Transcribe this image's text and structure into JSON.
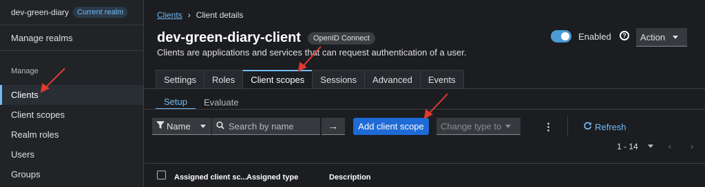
{
  "sidebar": {
    "realm_name": "dev-green-diary",
    "realm_badge": "Current realm",
    "manage_realms": "Manage realms",
    "section_label": "Manage",
    "items": [
      {
        "label": "Clients"
      },
      {
        "label": "Client scopes"
      },
      {
        "label": "Realm roles"
      },
      {
        "label": "Users"
      },
      {
        "label": "Groups"
      }
    ]
  },
  "breadcrumb": {
    "parent": "Clients",
    "current": "Client details"
  },
  "header": {
    "title": "dev-green-diary-client",
    "protocol_badge": "OpenID Connect",
    "subtitle": "Clients are applications and services that can request authentication of a user.",
    "enabled_label": "Enabled",
    "enabled": true,
    "action_label": "Action"
  },
  "tabs": [
    {
      "label": "Settings"
    },
    {
      "label": "Roles"
    },
    {
      "label": "Client scopes"
    },
    {
      "label": "Sessions"
    },
    {
      "label": "Advanced"
    },
    {
      "label": "Events"
    }
  ],
  "subtabs": [
    {
      "label": "Setup"
    },
    {
      "label": "Evaluate"
    }
  ],
  "toolbar": {
    "filter_label": "Name",
    "search_placeholder": "Search by name",
    "add_label": "Add client scope",
    "change_type_label": "Change type to",
    "refresh_label": "Refresh"
  },
  "pagination": {
    "range": "1 - 14"
  },
  "table": {
    "columns": [
      "Assigned client sc...",
      "Assigned type",
      "Description"
    ]
  },
  "colors": {
    "accent": "#73bcf7",
    "primary_button": "#1f6bd6",
    "annotation_arrow": "#e03a2f"
  },
  "icons": [
    "filter-icon",
    "search-icon",
    "arrow-right-icon",
    "kebab-icon",
    "refresh-icon",
    "help-icon",
    "chevron-left-icon",
    "chevron-right-icon"
  ]
}
